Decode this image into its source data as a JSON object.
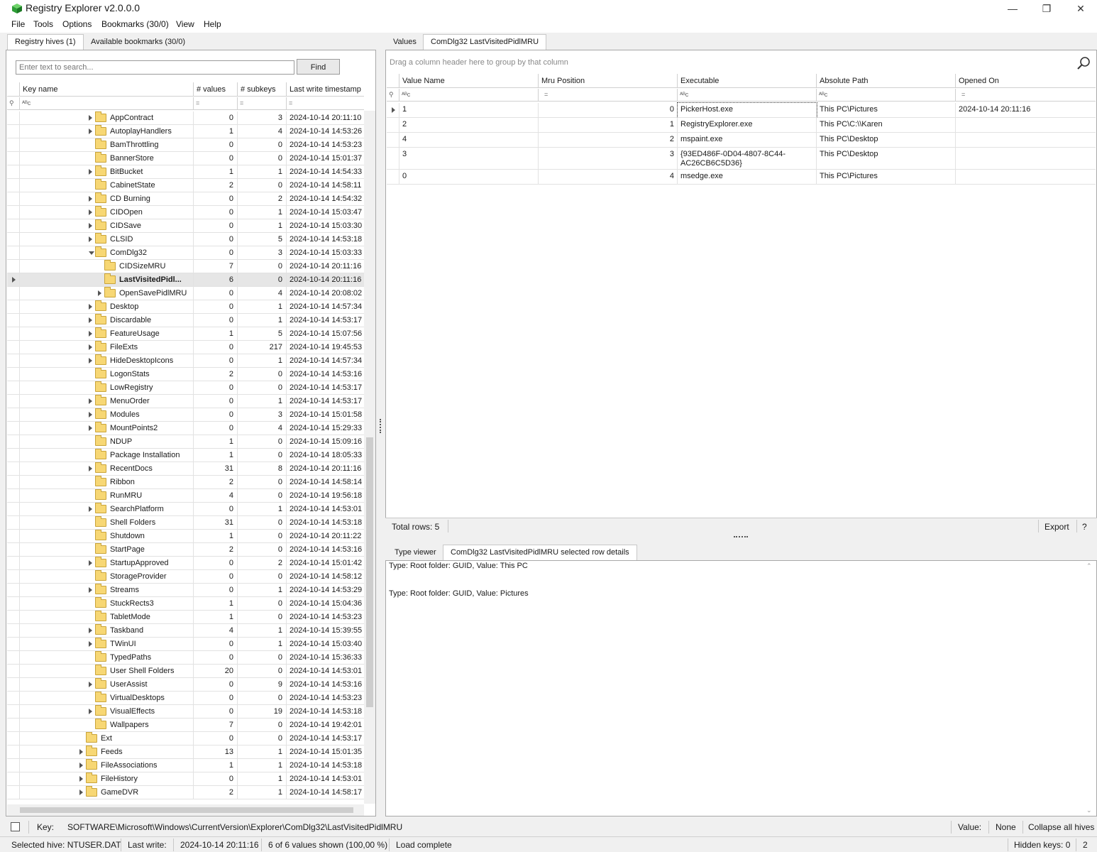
{
  "window": {
    "title": "Registry Explorer v2.0.0.0",
    "min_glyph": "—",
    "max_glyph": "❐",
    "close_glyph": "✕"
  },
  "menu": [
    "File",
    "Tools",
    "Options",
    "Bookmarks (30/0)",
    "View",
    "Help"
  ],
  "left_tabs": [
    "Registry hives (1)",
    "Available bookmarks (30/0)"
  ],
  "search": {
    "placeholder": "Enter text to search...",
    "find_label": "Find"
  },
  "tree": {
    "columns": [
      "Key name",
      "# values",
      "# subkeys",
      "Last write timestamp"
    ],
    "filter_text": "ᴬᴮc",
    "filter_eq": "=",
    "rows": [
      {
        "name": "AppContract",
        "values": "0",
        "subkeys": "3",
        "ts": "2024-10-14 20:11:10",
        "level": 2,
        "exp": "closed"
      },
      {
        "name": "AutoplayHandlers",
        "values": "1",
        "subkeys": "4",
        "ts": "2024-10-14 14:53:26",
        "level": 2,
        "exp": "closed"
      },
      {
        "name": "BamThrottling",
        "values": "0",
        "subkeys": "0",
        "ts": "2024-10-14 14:53:23",
        "level": 2,
        "exp": "none"
      },
      {
        "name": "BannerStore",
        "values": "0",
        "subkeys": "0",
        "ts": "2024-10-14 15:01:37",
        "level": 2,
        "exp": "none"
      },
      {
        "name": "BitBucket",
        "values": "1",
        "subkeys": "1",
        "ts": "2024-10-14 14:54:33",
        "level": 2,
        "exp": "closed"
      },
      {
        "name": "CabinetState",
        "values": "2",
        "subkeys": "0",
        "ts": "2024-10-14 14:58:11",
        "level": 2,
        "exp": "none"
      },
      {
        "name": "CD Burning",
        "values": "0",
        "subkeys": "2",
        "ts": "2024-10-14 14:54:32",
        "level": 2,
        "exp": "closed"
      },
      {
        "name": "CIDOpen",
        "values": "0",
        "subkeys": "1",
        "ts": "2024-10-14 15:03:47",
        "level": 2,
        "exp": "closed"
      },
      {
        "name": "CIDSave",
        "values": "0",
        "subkeys": "1",
        "ts": "2024-10-14 15:03:30",
        "level": 2,
        "exp": "closed"
      },
      {
        "name": "CLSID",
        "values": "0",
        "subkeys": "5",
        "ts": "2024-10-14 14:53:18",
        "level": 2,
        "exp": "closed"
      },
      {
        "name": "ComDlg32",
        "values": "0",
        "subkeys": "3",
        "ts": "2024-10-14 15:03:33",
        "level": 2,
        "exp": "open"
      },
      {
        "name": "CIDSizeMRU",
        "values": "7",
        "subkeys": "0",
        "ts": "2024-10-14 20:11:16",
        "level": 3,
        "exp": "none"
      },
      {
        "name": "LastVisitedPidl...",
        "values": "6",
        "subkeys": "0",
        "ts": "2024-10-14 20:11:16",
        "level": 3,
        "exp": "none",
        "selected": true
      },
      {
        "name": "OpenSavePidlMRU",
        "values": "0",
        "subkeys": "4",
        "ts": "2024-10-14 20:08:02",
        "level": 3,
        "exp": "closed"
      },
      {
        "name": "Desktop",
        "values": "0",
        "subkeys": "1",
        "ts": "2024-10-14 14:57:34",
        "level": 2,
        "exp": "closed"
      },
      {
        "name": "Discardable",
        "values": "0",
        "subkeys": "1",
        "ts": "2024-10-14 14:53:17",
        "level": 2,
        "exp": "closed"
      },
      {
        "name": "FeatureUsage",
        "values": "1",
        "subkeys": "5",
        "ts": "2024-10-14 15:07:56",
        "level": 2,
        "exp": "closed"
      },
      {
        "name": "FileExts",
        "values": "0",
        "subkeys": "217",
        "ts": "2024-10-14 19:45:53",
        "level": 2,
        "exp": "closed"
      },
      {
        "name": "HideDesktopIcons",
        "values": "0",
        "subkeys": "1",
        "ts": "2024-10-14 14:57:34",
        "level": 2,
        "exp": "closed"
      },
      {
        "name": "LogonStats",
        "values": "2",
        "subkeys": "0",
        "ts": "2024-10-14 14:53:16",
        "level": 2,
        "exp": "none"
      },
      {
        "name": "LowRegistry",
        "values": "0",
        "subkeys": "0",
        "ts": "2024-10-14 14:53:17",
        "level": 2,
        "exp": "none"
      },
      {
        "name": "MenuOrder",
        "values": "0",
        "subkeys": "1",
        "ts": "2024-10-14 14:53:17",
        "level": 2,
        "exp": "closed"
      },
      {
        "name": "Modules",
        "values": "0",
        "subkeys": "3",
        "ts": "2024-10-14 15:01:58",
        "level": 2,
        "exp": "closed"
      },
      {
        "name": "MountPoints2",
        "values": "0",
        "subkeys": "4",
        "ts": "2024-10-14 15:29:33",
        "level": 2,
        "exp": "closed"
      },
      {
        "name": "NDUP",
        "values": "1",
        "subkeys": "0",
        "ts": "2024-10-14 15:09:16",
        "level": 2,
        "exp": "none"
      },
      {
        "name": "Package Installation",
        "values": "1",
        "subkeys": "0",
        "ts": "2024-10-14 18:05:33",
        "level": 2,
        "exp": "none"
      },
      {
        "name": "RecentDocs",
        "values": "31",
        "subkeys": "8",
        "ts": "2024-10-14 20:11:16",
        "level": 2,
        "exp": "closed"
      },
      {
        "name": "Ribbon",
        "values": "2",
        "subkeys": "0",
        "ts": "2024-10-14 14:58:14",
        "level": 2,
        "exp": "none"
      },
      {
        "name": "RunMRU",
        "values": "4",
        "subkeys": "0",
        "ts": "2024-10-14 19:56:18",
        "level": 2,
        "exp": "none"
      },
      {
        "name": "SearchPlatform",
        "values": "0",
        "subkeys": "1",
        "ts": "2024-10-14 14:53:01",
        "level": 2,
        "exp": "closed"
      },
      {
        "name": "Shell Folders",
        "values": "31",
        "subkeys": "0",
        "ts": "2024-10-14 14:53:18",
        "level": 2,
        "exp": "none"
      },
      {
        "name": "Shutdown",
        "values": "1",
        "subkeys": "0",
        "ts": "2024-10-14 20:11:22",
        "level": 2,
        "exp": "none"
      },
      {
        "name": "StartPage",
        "values": "2",
        "subkeys": "0",
        "ts": "2024-10-14 14:53:16",
        "level": 2,
        "exp": "none"
      },
      {
        "name": "StartupApproved",
        "values": "0",
        "subkeys": "2",
        "ts": "2024-10-14 15:01:42",
        "level": 2,
        "exp": "closed"
      },
      {
        "name": "StorageProvider",
        "values": "0",
        "subkeys": "0",
        "ts": "2024-10-14 14:58:12",
        "level": 2,
        "exp": "none"
      },
      {
        "name": "Streams",
        "values": "0",
        "subkeys": "1",
        "ts": "2024-10-14 14:53:29",
        "level": 2,
        "exp": "closed"
      },
      {
        "name": "StuckRects3",
        "values": "1",
        "subkeys": "0",
        "ts": "2024-10-14 15:04:36",
        "level": 2,
        "exp": "none"
      },
      {
        "name": "TabletMode",
        "values": "1",
        "subkeys": "0",
        "ts": "2024-10-14 14:53:23",
        "level": 2,
        "exp": "none"
      },
      {
        "name": "Taskband",
        "values": "4",
        "subkeys": "1",
        "ts": "2024-10-14 15:39:55",
        "level": 2,
        "exp": "closed"
      },
      {
        "name": "TWinUI",
        "values": "0",
        "subkeys": "1",
        "ts": "2024-10-14 15:03:40",
        "level": 2,
        "exp": "closed"
      },
      {
        "name": "TypedPaths",
        "values": "0",
        "subkeys": "0",
        "ts": "2024-10-14 15:36:33",
        "level": 2,
        "exp": "none"
      },
      {
        "name": "User Shell Folders",
        "values": "20",
        "subkeys": "0",
        "ts": "2024-10-14 14:53:01",
        "level": 2,
        "exp": "none"
      },
      {
        "name": "UserAssist",
        "values": "0",
        "subkeys": "9",
        "ts": "2024-10-14 14:53:16",
        "level": 2,
        "exp": "closed"
      },
      {
        "name": "VirtualDesktops",
        "values": "0",
        "subkeys": "0",
        "ts": "2024-10-14 14:53:23",
        "level": 2,
        "exp": "none"
      },
      {
        "name": "VisualEffects",
        "values": "0",
        "subkeys": "19",
        "ts": "2024-10-14 14:53:18",
        "level": 2,
        "exp": "closed"
      },
      {
        "name": "Wallpapers",
        "values": "7",
        "subkeys": "0",
        "ts": "2024-10-14 19:42:01",
        "level": 2,
        "exp": "none"
      },
      {
        "name": "Ext",
        "values": "0",
        "subkeys": "0",
        "ts": "2024-10-14 14:53:17",
        "level": 1,
        "exp": "none"
      },
      {
        "name": "Feeds",
        "values": "13",
        "subkeys": "1",
        "ts": "2024-10-14 15:01:35",
        "level": 1,
        "exp": "closed"
      },
      {
        "name": "FileAssociations",
        "values": "1",
        "subkeys": "1",
        "ts": "2024-10-14 14:53:18",
        "level": 1,
        "exp": "closed"
      },
      {
        "name": "FileHistory",
        "values": "0",
        "subkeys": "1",
        "ts": "2024-10-14 14:53:01",
        "level": 1,
        "exp": "closed"
      },
      {
        "name": "GameDVR",
        "values": "2",
        "subkeys": "1",
        "ts": "2024-10-14 14:58:17",
        "level": 1,
        "exp": "closed"
      }
    ]
  },
  "right_tabs": [
    "Values",
    "ComDlg32 LastVisitedPidlMRU"
  ],
  "values_grid": {
    "group_hint": "Drag a column header here to group by that column",
    "columns": [
      "Value Name",
      "Mru Position",
      "Executable",
      "Absolute Path",
      "Opened On"
    ],
    "rows": [
      {
        "name": "1",
        "mru": "0",
        "exe": "PickerHost.exe",
        "path": "This PC\\Pictures",
        "opened": "2024-10-14 20:11:16"
      },
      {
        "name": "2",
        "mru": "1",
        "exe": "RegistryExplorer.exe",
        "path": "This PC\\C:\\\\Karen",
        "opened": ""
      },
      {
        "name": "4",
        "mru": "2",
        "exe": "mspaint.exe",
        "path": "This PC\\Desktop",
        "opened": ""
      },
      {
        "name": "3",
        "mru": "3",
        "exe": "{93ED486F-0D04-4807-8C44-AC26CB6C5D36}",
        "path": "This PC\\Desktop",
        "opened": ""
      },
      {
        "name": "0",
        "mru": "4",
        "exe": "msedge.exe",
        "path": "This PC\\Pictures",
        "opened": ""
      }
    ],
    "total_rows": "Total rows: 5",
    "export_label": "Export",
    "help_label": "?"
  },
  "bottom_tabs": [
    "Type viewer",
    "ComDlg32 LastVisitedPidlMRU selected row details"
  ],
  "details": [
    "Type: Root folder: GUID, Value: This PC",
    "Type: Root folder: GUID, Value: Pictures"
  ],
  "keybar": {
    "key_label": "Key:",
    "key_path": "SOFTWARE\\Microsoft\\Windows\\CurrentVersion\\Explorer\\ComDlg32\\LastVisitedPidlMRU",
    "value_label": "Value:",
    "value": "None",
    "collapse": "Collapse all hives"
  },
  "status": {
    "hive": "Selected hive: NTUSER.DAT",
    "last_write_label": "Last write:",
    "last_write": "2024-10-14 20:11:16",
    "values_shown": "6 of 6 values shown (100,00 %)",
    "load": "Load complete",
    "hidden": "Hidden keys: 0",
    "count": "2"
  },
  "colors": {
    "accent": "#0078d7",
    "selected_row": "#e6e6e6",
    "folder": "#f7d774"
  }
}
